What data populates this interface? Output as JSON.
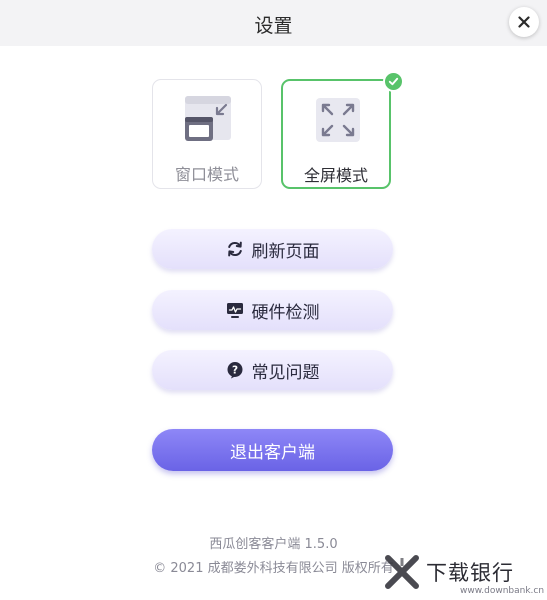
{
  "window": {
    "title": "设置",
    "close_glyph": "✕"
  },
  "modes": {
    "window_label": "窗口模式",
    "fullscreen_label": "全屏模式",
    "selected": "fullscreen"
  },
  "actions": {
    "refresh_label": "刷新页面",
    "hardware_label": "硬件检测",
    "faq_label": "常见问题",
    "faq_icon_glyph": "?",
    "exit_label": "退出客户端"
  },
  "footer": {
    "version": "西瓜创客客户端 1.5.0",
    "copyright": "© 2021 成都娄外科技有限公司 版权所有"
  },
  "watermark": {
    "text": "下载银行",
    "url": "www.downbank.cn"
  },
  "colors": {
    "accent_purple": "#6a63e6",
    "selected_green": "#58c36a",
    "button_lavender": "#e9e6fc"
  },
  "icons": {
    "close": "close-icon",
    "window_mode": "window-mode-icon",
    "fullscreen_mode": "fullscreen-mode-icon",
    "check": "check-icon",
    "refresh": "refresh-icon",
    "hardware": "monitor-icon",
    "faq": "question-icon"
  }
}
